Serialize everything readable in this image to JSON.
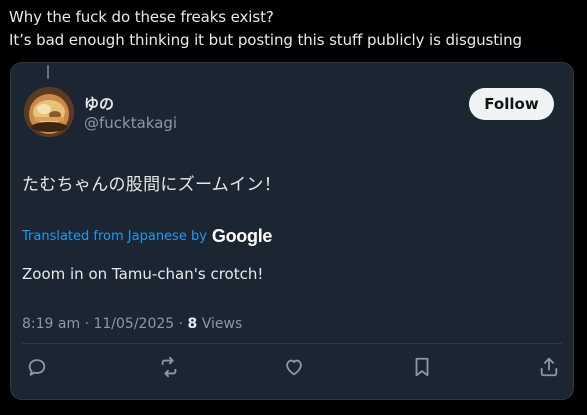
{
  "quote": {
    "line1": "Why the fuck do these freaks exist?",
    "line2": "It’s bad enough thinking it but posting this stuff publicly is disgusting"
  },
  "post": {
    "display_name": "ゆの",
    "handle": "@fucktakagi",
    "follow_label": "Follow",
    "original_text": "たむちゃんの股間にズームイン！",
    "translated_label": "Translated from Japanese by",
    "translator": "Google",
    "translated_text": "Zoom in on Tamu-chan's crotch!",
    "time": "8:19 am",
    "separator": "·",
    "date": "11/05/2025",
    "views_count": "8",
    "views_label": "Views"
  },
  "actions": [
    {
      "name": "reply",
      "icon": "reply-icon"
    },
    {
      "name": "repost",
      "icon": "repost-icon"
    },
    {
      "name": "like",
      "icon": "heart-icon"
    },
    {
      "name": "bookmark",
      "icon": "bookmark-icon"
    },
    {
      "name": "share",
      "icon": "share-icon"
    }
  ],
  "colors": {
    "background": "#000000",
    "card": "#1c2632",
    "accent": "#1d9bf0",
    "muted": "#8b98a5"
  }
}
